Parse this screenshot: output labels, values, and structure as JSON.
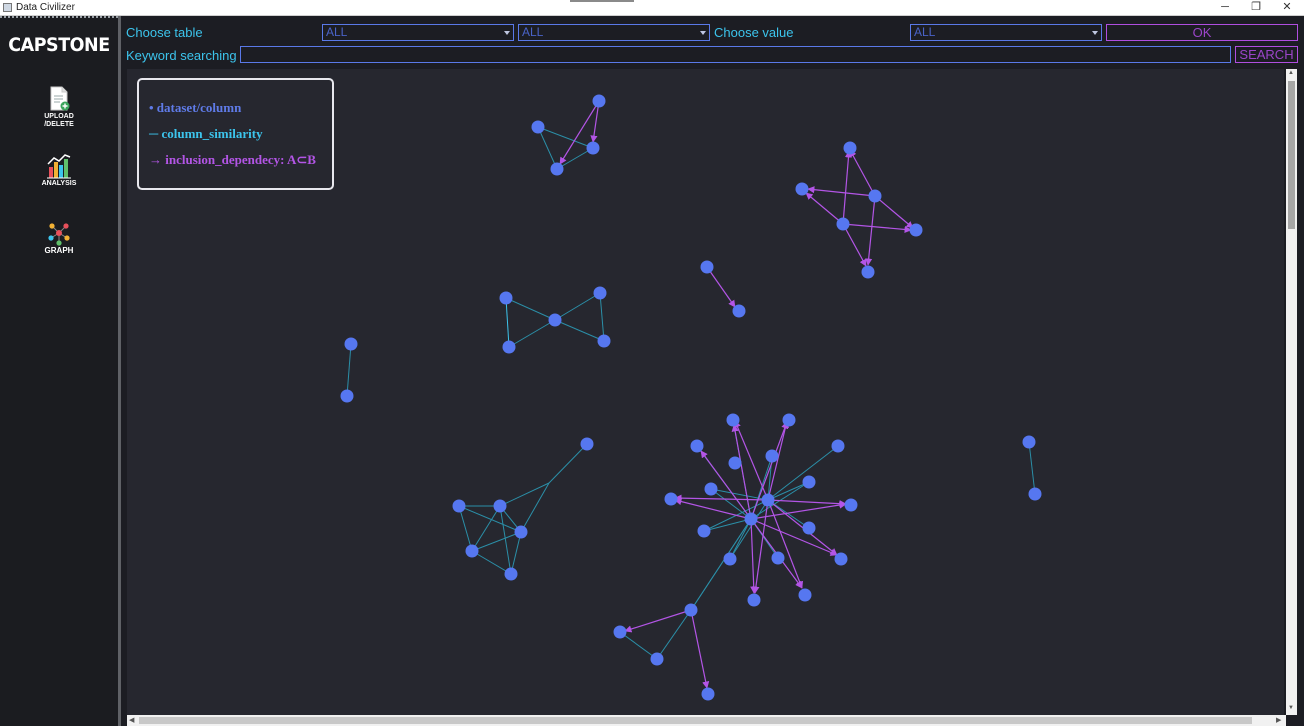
{
  "window": {
    "title": "Data Civilizer",
    "controls": {
      "minimize": "─",
      "restore": "❐",
      "close": "✕"
    }
  },
  "sidebar": {
    "logo": "CAPSTONE",
    "items": [
      {
        "id": "upload",
        "label": "UPLOAD\n/DELETE",
        "icon": "upload-document-icon"
      },
      {
        "id": "analysis",
        "label": "ANALYSIS",
        "icon": "bar-chart-icon"
      },
      {
        "id": "graph",
        "label": "GRAPH",
        "icon": "graph-network-icon"
      }
    ]
  },
  "toolbar": {
    "choose_table_label": "Choose table",
    "table_select_1": "ALL",
    "table_select_2": "ALL",
    "choose_value_label": "Choose value",
    "value_select": "ALL",
    "ok_label": "OK",
    "keyword_label": "Keyword searching",
    "keyword_value": "",
    "search_label": "SEARCH"
  },
  "legend": {
    "node": "• dataset/column",
    "similarity": "─ column_similarity",
    "inclusion": "→ inclusion_dependecy: A⊂B"
  },
  "colors": {
    "node": "#5677f0",
    "similarity": "#2b8fa8",
    "inclusion": "#b355e6",
    "label": "#3cc4ec",
    "legend_node": "#5f7be8",
    "legend_similarity": "#3cc4ec",
    "legend_inclusion": "#b355e6"
  }
}
